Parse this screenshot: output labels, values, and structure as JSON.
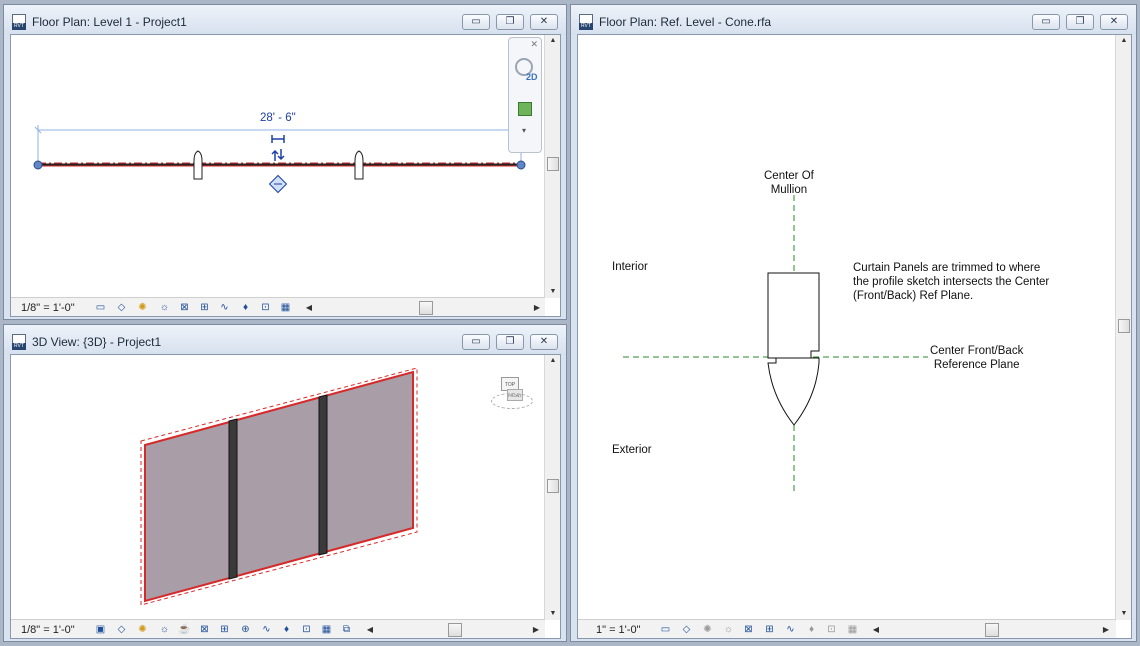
{
  "windows": {
    "floor_plan_level1": {
      "title": "Floor Plan: Level 1 - Project1",
      "scale": "1/8\" = 1'-0\"",
      "dimension": "28' - 6\""
    },
    "view_3d": {
      "title": "3D View: {3D} - Project1",
      "scale": "1/8\" = 1'-0\""
    },
    "floor_plan_ref_level": {
      "title": "Floor Plan: Ref. Level - Cone.rfa",
      "scale": "1\" = 1'-0\"",
      "annotations": {
        "center_mullion": "Center Of\nMullion",
        "interior": "Interior",
        "exterior": "Exterior",
        "trim_note": "Curtain Panels are trimmed to where\nthe profile sketch intersects the Center\n(Front/Back) Ref Plane.",
        "center_front_back": "Center Front/Back\nReference Plane"
      }
    }
  },
  "window_buttons": {
    "minimize": "▭",
    "restore": "❐",
    "close": "✕"
  },
  "view_cube_labels": {
    "top": "TOP",
    "front": "FRONT"
  },
  "nav_bar": {
    "mode_label": "2D"
  },
  "icons": [
    "doc-icon",
    "minimize-icon",
    "restore-icon",
    "close-icon",
    "steering-wheel-icon",
    "zoom-icon",
    "view-cube-icon"
  ],
  "colors": {
    "accent": "#1e3fa8",
    "red_line": "#d62a2a",
    "panel_fill": "#a99ea8",
    "ref_plane_green": "#2a8a2a"
  }
}
